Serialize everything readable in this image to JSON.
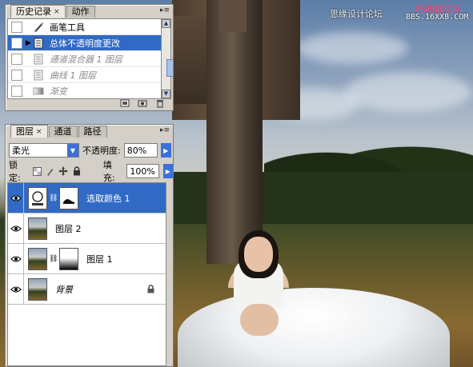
{
  "watermark": {
    "site_cn": "思缘设计论坛",
    "site_ps": "PS教程论坛",
    "site_url": "BBS.16XX8.COM"
  },
  "history_panel": {
    "tabs": [
      {
        "label": "历史记录",
        "active": true,
        "close": "×"
      },
      {
        "label": "动作",
        "active": false
      }
    ],
    "menu_glyph": "▸≡",
    "items": [
      {
        "label": "画笔工具",
        "state": "normal",
        "icon": "brush-icon"
      },
      {
        "label": "总体不透明度更改",
        "state": "selected",
        "icon": "history-state-icon"
      },
      {
        "label": "通道混合器 1 图层",
        "state": "undone",
        "icon": "history-state-icon"
      },
      {
        "label": "曲线 1 图层",
        "state": "undone",
        "icon": "history-state-icon"
      },
      {
        "label": "渐变",
        "state": "undone",
        "icon": "gradient-icon"
      }
    ],
    "bottom_icons": [
      "new-document-icon",
      "snapshot-icon",
      "trash-icon"
    ]
  },
  "layers_panel": {
    "tabs": [
      {
        "label": "图层",
        "active": true,
        "close": "×"
      },
      {
        "label": "通道",
        "active": false
      },
      {
        "label": "路径",
        "active": false
      }
    ],
    "blend_mode": "柔光",
    "opacity_label": "不透明度:",
    "opacity_value": "80%",
    "lock_label": "锁定:",
    "fill_label": "填充:",
    "fill_value": "100%",
    "layers": [
      {
        "name": "选取颜色 1",
        "selected": true,
        "kind": "adjustment",
        "has_mask": true,
        "locked": false
      },
      {
        "name": "图层 2",
        "selected": false,
        "kind": "pixel",
        "has_mask": false,
        "locked": false
      },
      {
        "name": "图层 1",
        "selected": false,
        "kind": "pixel",
        "has_mask": true,
        "locked": false
      },
      {
        "name": "背景",
        "selected": false,
        "kind": "background",
        "has_mask": false,
        "locked": true
      }
    ]
  },
  "colors": {
    "selection": "#316ac5",
    "panel_bg": "#d4d0c8",
    "accent_blue": "#3c6fd8"
  }
}
